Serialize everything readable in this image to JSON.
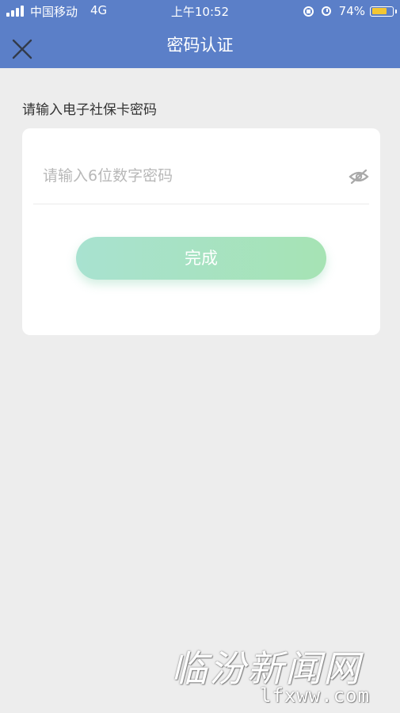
{
  "status_bar": {
    "carrier": "中国移动",
    "network": "4G",
    "time": "上午10:52",
    "battery_percent": "74%",
    "battery_level": 0.74,
    "battery_color": "#f3c633"
  },
  "nav": {
    "title": "密码认证",
    "close_icon": "close-icon",
    "bar_color": "#5b7fc8"
  },
  "form": {
    "label": "请输入电子社保卡密码",
    "password_placeholder": "请输入6位数字密码",
    "password_value": "",
    "visibility_icon": "eye-hidden-icon",
    "done_label": "完成"
  },
  "watermark": {
    "brand": "临汾新闻网",
    "domain": "lfxww.com"
  }
}
